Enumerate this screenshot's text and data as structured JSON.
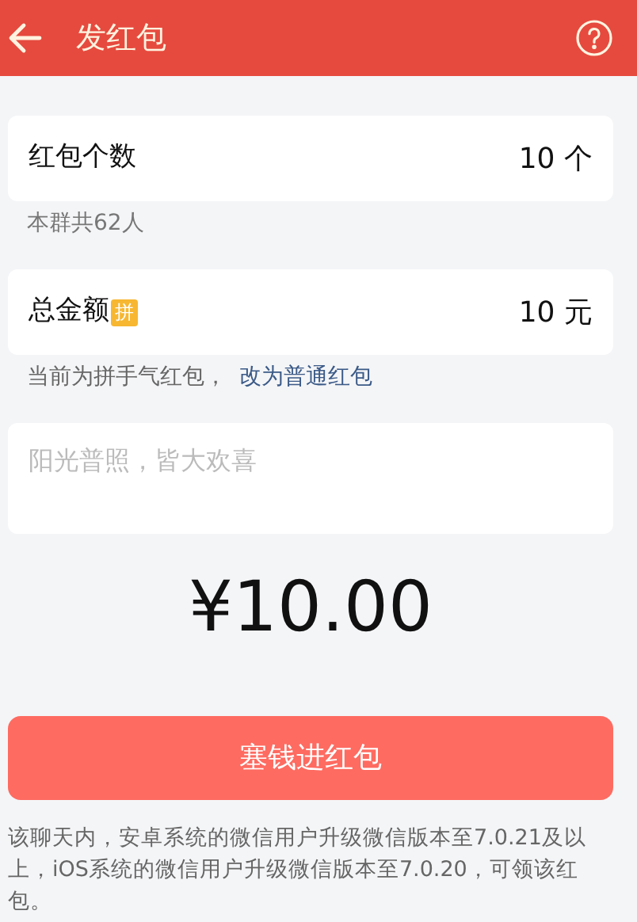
{
  "header": {
    "title": "发红包"
  },
  "count_field": {
    "label": "红包个数",
    "value": "10",
    "unit": "个"
  },
  "count_hint": "本群共62人",
  "amount_field": {
    "label": "总金额",
    "badge": "拼",
    "value": "10",
    "unit": "元"
  },
  "mode_hint": {
    "text": "当前为拼手气红包，",
    "link": "改为普通红包"
  },
  "greeting_field": {
    "placeholder": "阳光普照，皆大欢喜"
  },
  "total": "¥10.00",
  "submit_button": "塞钱进红包",
  "notice": "该聊天内，安卓系统的微信用户升级微信版本至7.0.21及以上，iOS系统的微信用户升级微信版本至7.0.20，可领该红包。"
}
